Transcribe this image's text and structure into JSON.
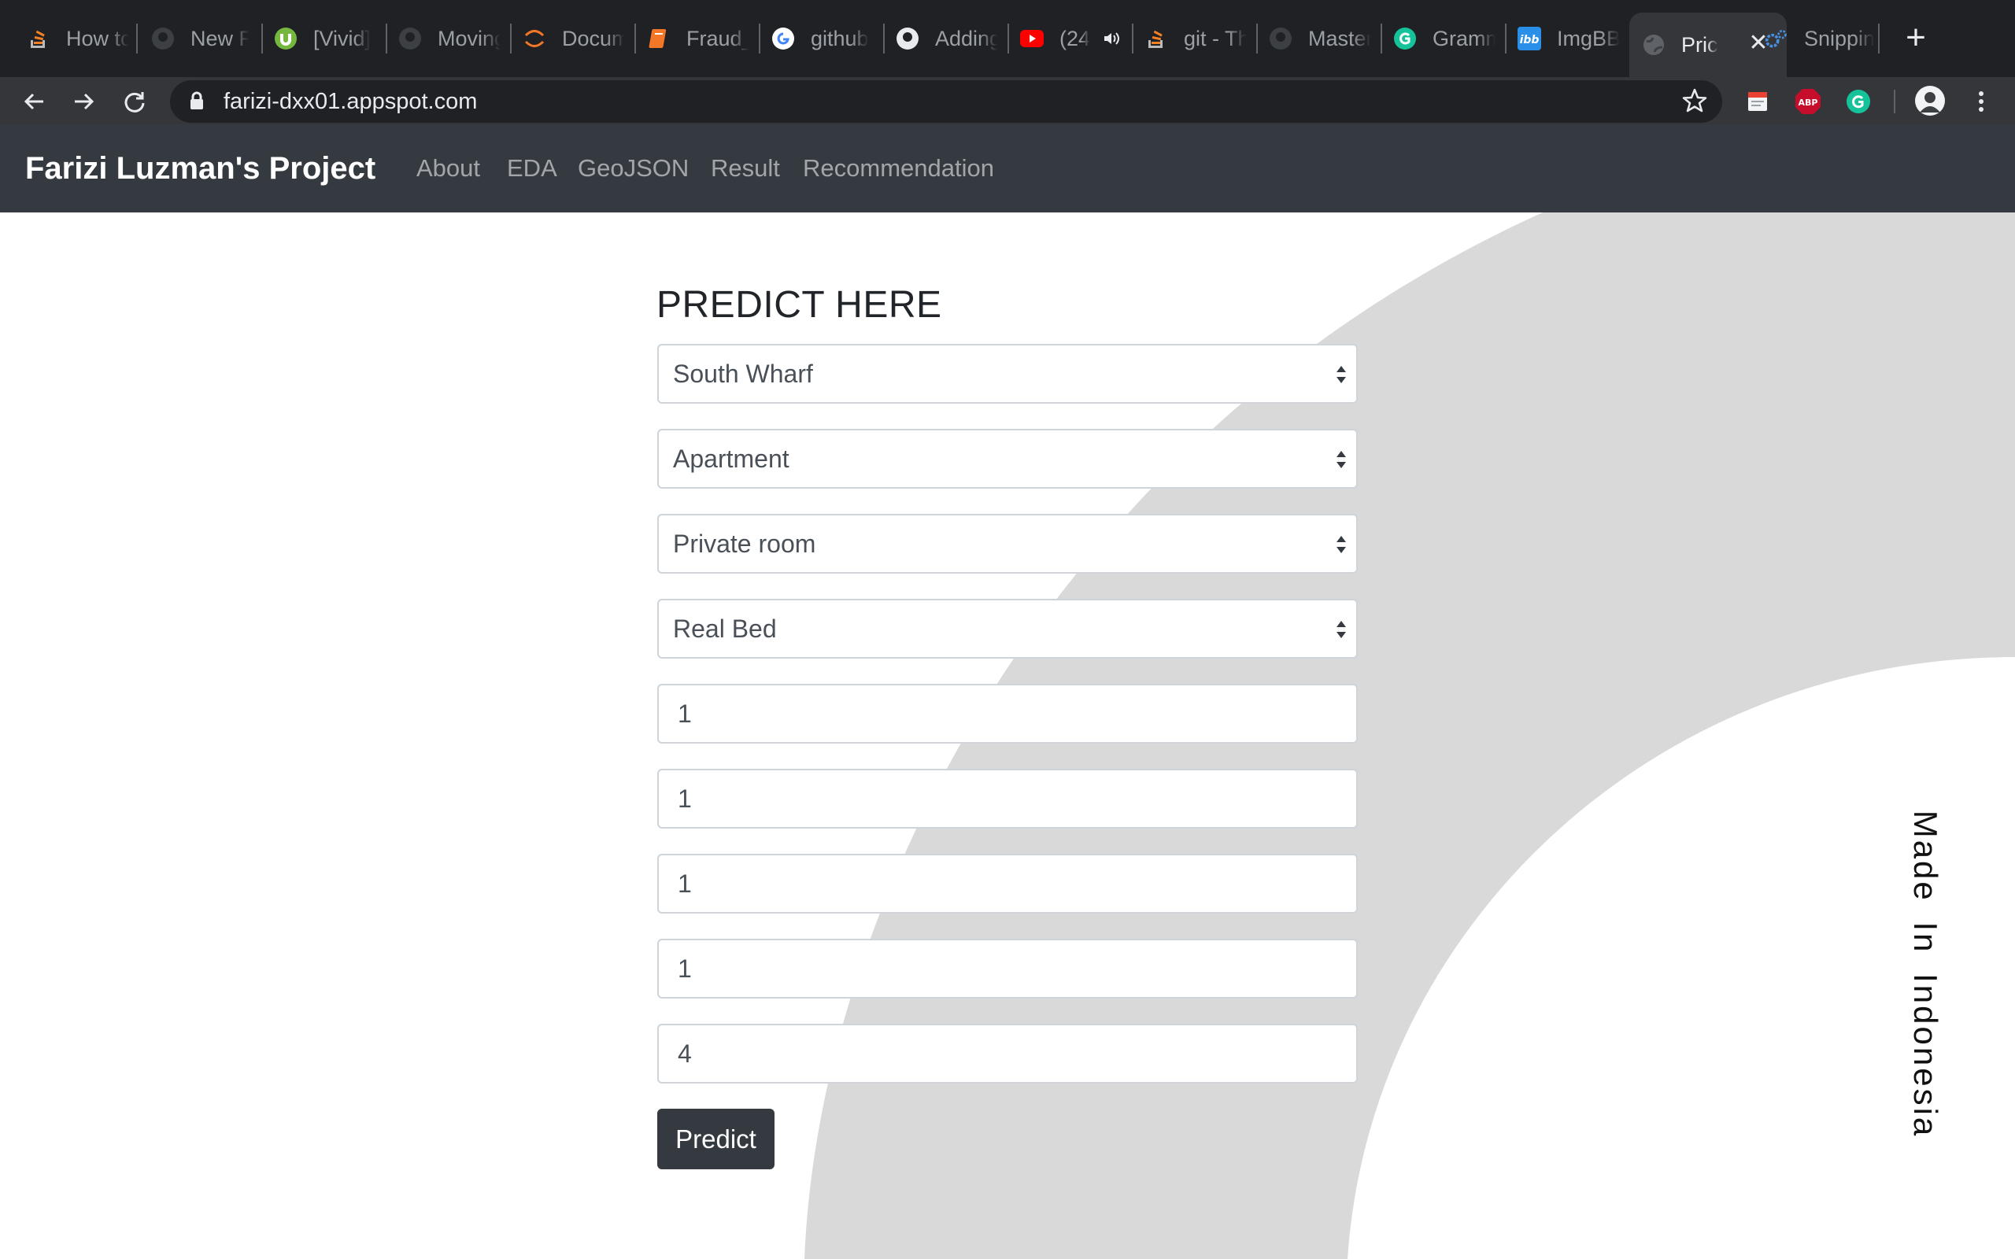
{
  "browser": {
    "tabs": [
      {
        "label": "How to",
        "icon": "stackoverflow-icon"
      },
      {
        "label": "New Fi",
        "icon": "github-icon"
      },
      {
        "label": "[Vivid]",
        "icon": "utorrent-icon"
      },
      {
        "label": "Moving",
        "icon": "github-icon"
      },
      {
        "label": "Docum",
        "icon": "jupyter-icon"
      },
      {
        "label": "Fraud_I",
        "icon": "notebook-icon"
      },
      {
        "label": "github",
        "icon": "google-icon"
      },
      {
        "label": "Adding",
        "icon": "github-icon"
      },
      {
        "label": "(24",
        "icon": "youtube-icon"
      },
      {
        "label": "git - Th",
        "icon": "stackoverflow-icon"
      },
      {
        "label": "Master",
        "icon": "github-icon"
      },
      {
        "label": "Gramm",
        "icon": "grammarly-icon"
      },
      {
        "label": "ImgBB",
        "icon": "imgbb-icon"
      },
      {
        "label": "Pric",
        "icon": "globe-icon"
      },
      {
        "label": "Snippin",
        "icon": "gear-icon"
      }
    ],
    "active_tab_index": 13,
    "url": "farizi-dxx01.appspot.com",
    "extensions": [
      "notes-extension-icon",
      "adblock-plus-icon",
      "grammarly-icon",
      "profile-avatar"
    ],
    "abp_label": "ABP"
  },
  "navbar": {
    "brand": "Farizi Luzman's Project",
    "links": [
      "About",
      "EDA",
      "GeoJSON",
      "Result",
      "Recommendation"
    ]
  },
  "form": {
    "title": "PREDICT HERE",
    "selects": [
      {
        "name": "neighbourhood",
        "value": "South Wharf"
      },
      {
        "name": "property-type",
        "value": "Apartment"
      },
      {
        "name": "room-type",
        "value": "Private room"
      },
      {
        "name": "bed-type",
        "value": "Real Bed"
      }
    ],
    "inputs": [
      {
        "name": "input-1",
        "value": "1"
      },
      {
        "name": "input-2",
        "value": "1"
      },
      {
        "name": "input-3",
        "value": "1"
      },
      {
        "name": "input-4",
        "value": "1"
      },
      {
        "name": "input-5",
        "value": "4"
      }
    ],
    "submit_label": "Predict"
  },
  "footer_note": "Made In Indonesia",
  "colors": {
    "navbar": "#343a40",
    "button": "#343a40",
    "background_shape": "#d9d9d9",
    "tab_strip": "#202124"
  }
}
